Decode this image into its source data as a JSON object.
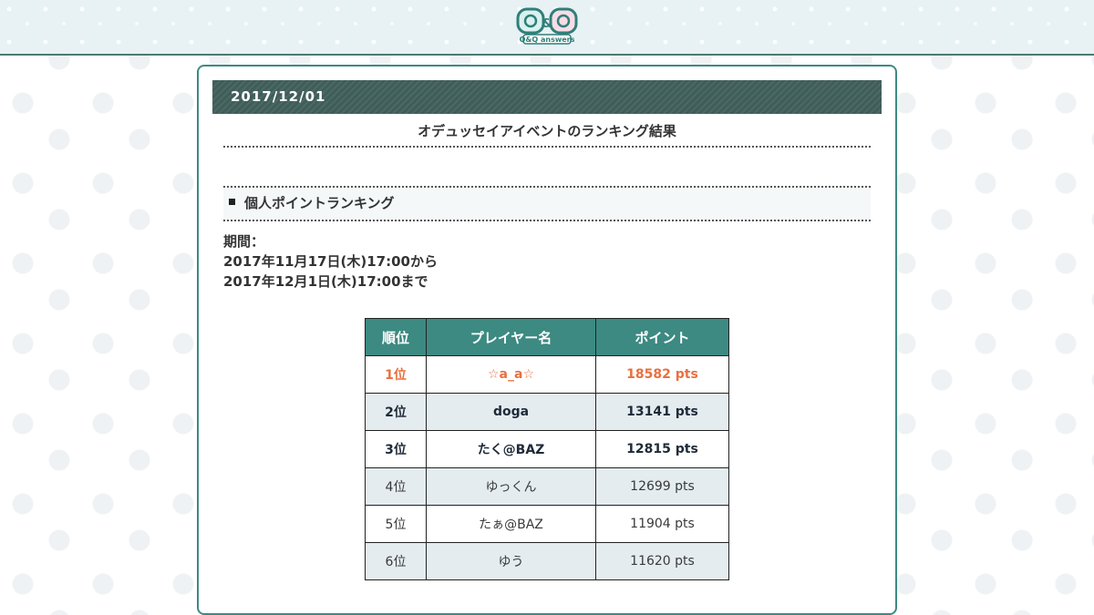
{
  "header": {
    "logo_alt": "Q&Q answers"
  },
  "article": {
    "date": "2017/12/01",
    "title": "オデュッセイアイベントのランキング結果",
    "section_heading": "個人ポイントランキング",
    "period_label": "期間：",
    "period_start": "2017年11月17日(木)17:00から",
    "period_end": "2017年12月1日(木)17:00まで"
  },
  "table": {
    "headers": [
      "順位",
      "プレイヤー名",
      "ポイント"
    ],
    "rows": [
      {
        "rank": "1位",
        "name": "☆a_a☆",
        "points": "18582 pts"
      },
      {
        "rank": "2位",
        "name": "doga",
        "points": "13141 pts"
      },
      {
        "rank": "3位",
        "name": "たく@BAZ",
        "points": "12815 pts"
      },
      {
        "rank": "4位",
        "name": "ゆっくん",
        "points": "12699 pts"
      },
      {
        "rank": "5位",
        "name": "たぁ@BAZ",
        "points": "11904 pts"
      },
      {
        "rank": "6位",
        "name": "ゆう",
        "points": "11620 pts"
      }
    ]
  },
  "colors": {
    "accent": "#3c8a82",
    "date_bar": "#3f5d59",
    "first_place": "#e8703f"
  }
}
